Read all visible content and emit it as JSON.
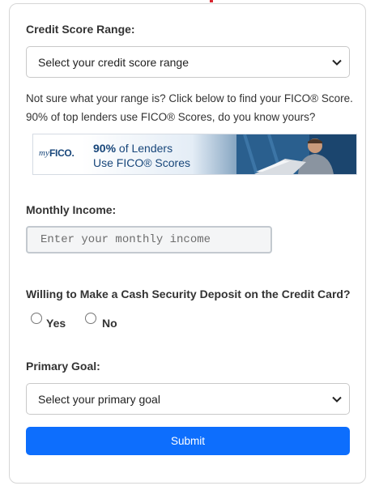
{
  "credit_score": {
    "label": "Credit Score Range:",
    "selected": "Select your credit score range"
  },
  "help": {
    "line1": "Not sure what your range is? Click below to find your FICO® Score.",
    "line2": "90% of top lenders use FICO® Scores, do you know yours?"
  },
  "banner": {
    "logo_my": "my",
    "logo_fico": "FICO.",
    "headline_bold": "90%",
    "headline_rest": " of Lenders",
    "subline": "Use FICO® Scores"
  },
  "income": {
    "label": "Monthly Income:",
    "placeholder": "Enter your monthly income",
    "value": ""
  },
  "deposit": {
    "label": "Willing to Make a Cash Security Deposit on the Credit Card?",
    "options": [
      "Yes",
      "No"
    ]
  },
  "goal": {
    "label": "Primary Goal:",
    "selected": "Select your primary goal"
  },
  "submit_label": "Submit",
  "colors": {
    "primary": "#0d6efd",
    "fico_blue": "#17467a",
    "accent_red": "#d8252f"
  }
}
